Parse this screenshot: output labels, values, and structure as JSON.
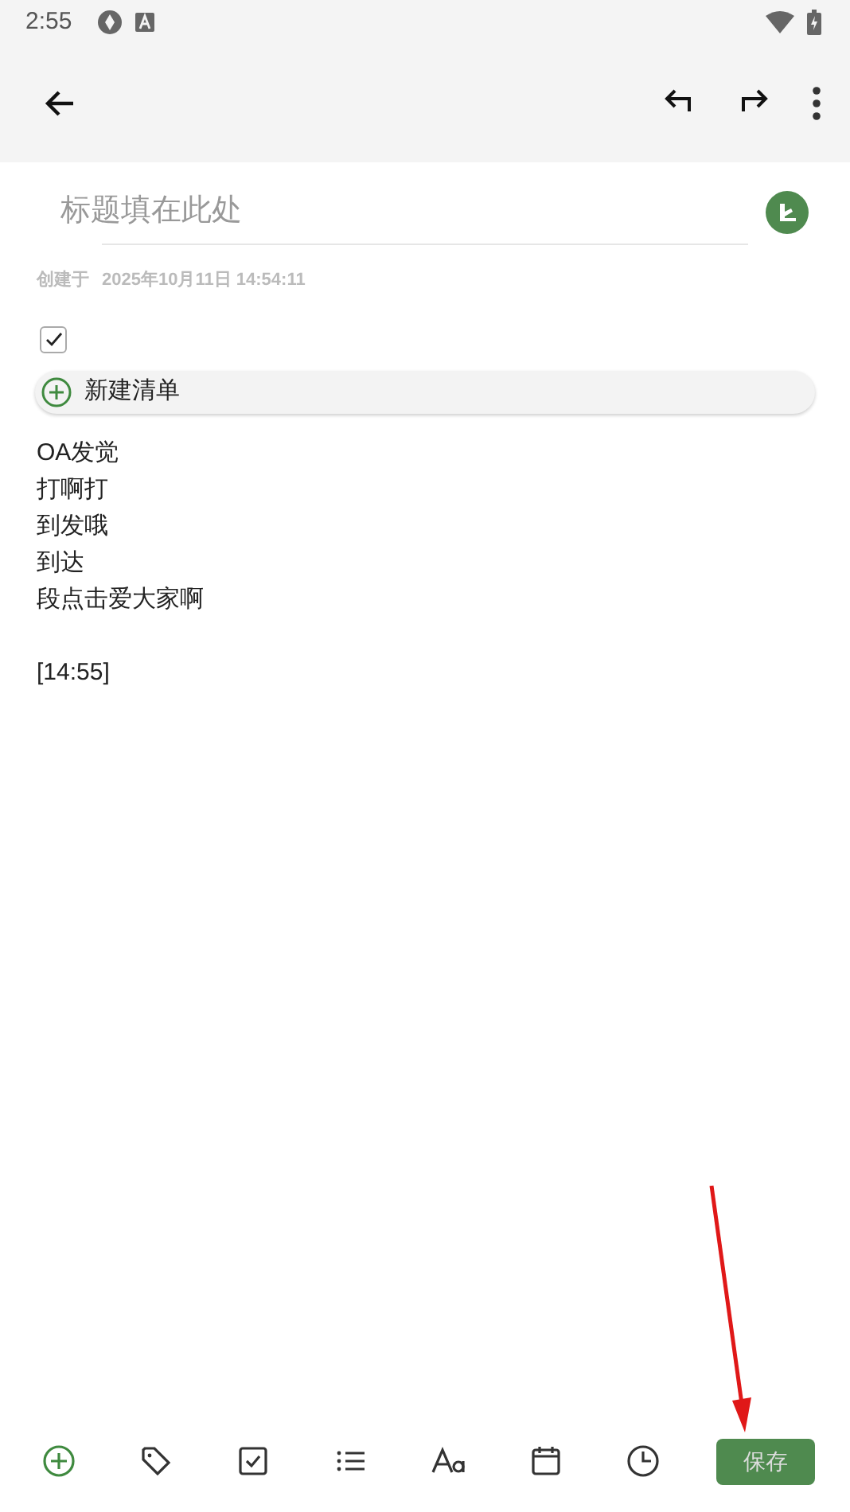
{
  "status_bar": {
    "time": "2:55"
  },
  "title": {
    "placeholder": "标题填在此处"
  },
  "created": {
    "label": "创建于",
    "datetime": "2025年10月11日 14:54:11"
  },
  "checklist": {
    "checked": true,
    "new_label": "新建清单"
  },
  "body_lines": [
    "OA发觉",
    "打啊打",
    "到发哦",
    "到达",
    "段点击爱大家啊"
  ],
  "timestamp": "[14:55]",
  "bottom_toolbar": {
    "save_label": "保存"
  }
}
